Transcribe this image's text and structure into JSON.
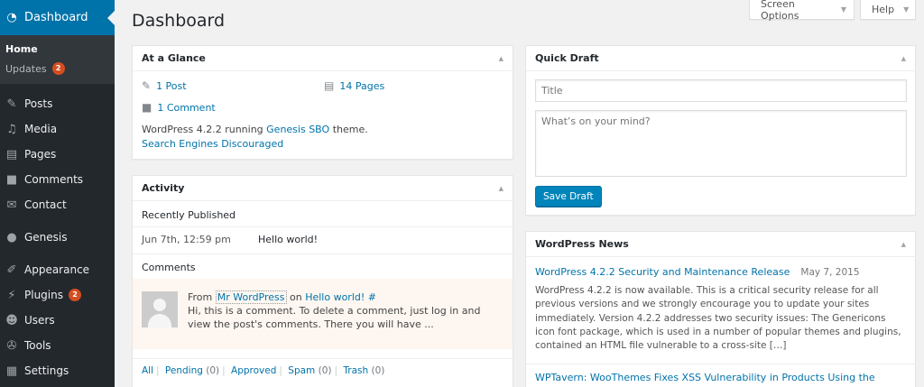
{
  "sidebar": {
    "dashboard": {
      "label": "Dashboard",
      "icon": "dashboard-icon"
    },
    "submenu": [
      {
        "label": "Home"
      },
      {
        "label": "Updates",
        "badge": "2"
      }
    ],
    "items": [
      {
        "label": "Posts",
        "icon": "pin-icon"
      },
      {
        "label": "Media",
        "icon": "media-icon"
      },
      {
        "label": "Pages",
        "icon": "pages-icon"
      },
      {
        "label": "Comments",
        "icon": "comment-icon"
      },
      {
        "label": "Contact",
        "icon": "envelope-icon"
      },
      {
        "label": "Genesis",
        "icon": "genesis-icon"
      },
      {
        "label": "Appearance",
        "icon": "brush-icon"
      },
      {
        "label": "Plugins",
        "icon": "plug-icon",
        "badge": "2"
      },
      {
        "label": "Users",
        "icon": "user-icon"
      },
      {
        "label": "Tools",
        "icon": "wrench-icon"
      },
      {
        "label": "Settings",
        "icon": "settings-icon"
      }
    ]
  },
  "header": {
    "title": "Dashboard",
    "screen_options": "Screen Options",
    "help": "Help"
  },
  "glance": {
    "title": "At a Glance",
    "posts": "1 Post",
    "pages": "14 Pages",
    "comments": "1 Comment",
    "version_pre": "WordPress 4.2.2 running",
    "theme": "Genesis SBO",
    "version_post": "theme.",
    "search_engines": "Search Engines Discouraged"
  },
  "activity": {
    "title": "Activity",
    "recently_published": "Recently Published",
    "post_date": "Jun 7th, 12:59 pm",
    "post_title": "Hello world!",
    "comments_heading": "Comments",
    "comment": {
      "from": "From",
      "author": "Mr WordPress",
      "on": "on",
      "post": "Hello world! #",
      "text": "Hi, this is a comment. To delete a comment, just log in and view the post's comments. There you will have ..."
    },
    "filters": {
      "all": "All",
      "pending": "Pending",
      "pending_count": "(0)",
      "approved": "Approved",
      "spam": "Spam",
      "spam_count": "(0)",
      "trash": "Trash",
      "trash_count": "(0)"
    }
  },
  "quick_draft": {
    "title": "Quick Draft",
    "title_placeholder": "Title",
    "content_placeholder": "What’s on your mind?",
    "save_label": "Save Draft"
  },
  "news": {
    "title": "WordPress News",
    "item1_title": "WordPress 4.2.2 Security and Maintenance Release",
    "item1_date": "May 7, 2015",
    "item1_body": "WordPress 4.2.2 is now available. This is a critical security release for all previous versions and we strongly encourage you to update your sites immediately. Version 4.2.2 addresses two security issues: The Genericons icon font package, which is used in a number of popular themes and plugins, contained an HTML file vulnerable to a cross-site […]",
    "item2_title": "WPTavern: WooThemes Fixes XSS Vulnerability in Products Using the"
  },
  "colors": {
    "sidebar_bg": "#23282d",
    "accent": "#0073aa",
    "badge": "#d54e21",
    "link": "#0073aa",
    "button": "#0085ba"
  }
}
